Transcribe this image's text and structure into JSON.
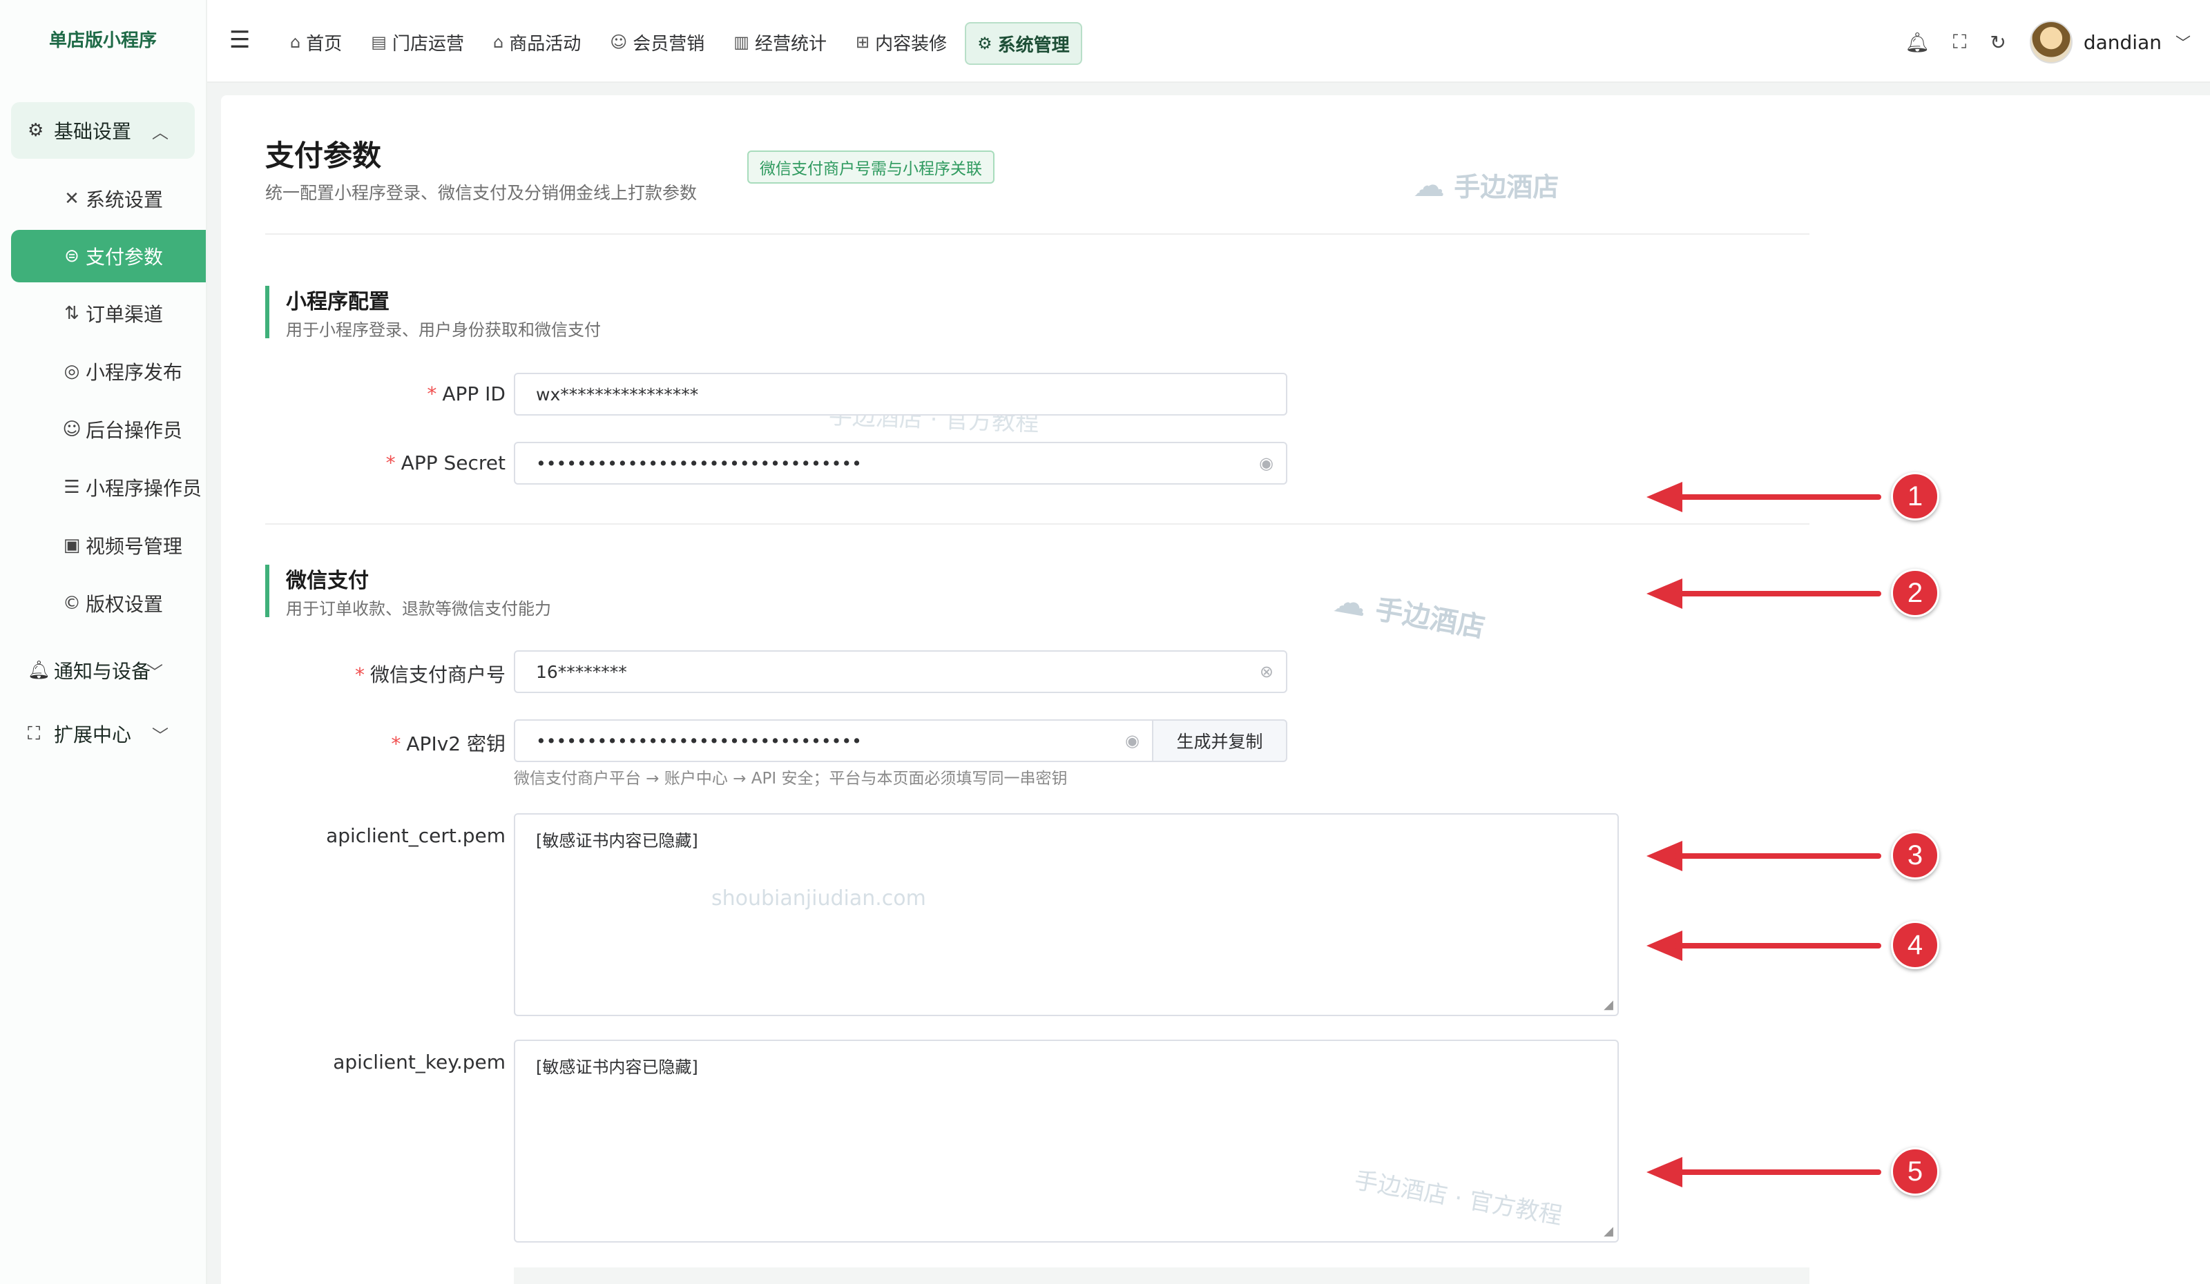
{
  "sidebar": {
    "brand": "单店版小程序",
    "group_basic": "基础设置",
    "items": [
      {
        "label": "系统设置",
        "icon": "tools-icon"
      },
      {
        "label": "支付参数",
        "icon": "wallet-icon"
      },
      {
        "label": "订单渠道",
        "icon": "channel-icon"
      },
      {
        "label": "小程序发布",
        "icon": "publish-icon"
      },
      {
        "label": "后台操作员",
        "icon": "user-circle-icon"
      },
      {
        "label": "小程序操作员",
        "icon": "users-list-icon"
      },
      {
        "label": "视频号管理",
        "icon": "video-icon"
      },
      {
        "label": "版权设置",
        "icon": "copyright-icon"
      }
    ],
    "group_notify": "通知与设备",
    "group_ext": "扩展中心"
  },
  "topbar": {
    "nav": [
      "首页",
      "门店运营",
      "商品活动",
      "会员营销",
      "经营统计",
      "内容装修",
      "系统管理"
    ],
    "username": "dandian"
  },
  "page": {
    "title": "支付参数",
    "subtitle": "统一配置小程序登录、微信支付及分销佣金线上打款参数",
    "tag": "微信支付商户号需与小程序关联"
  },
  "mini": {
    "title": "小程序配置",
    "subtitle": "用于小程序登录、用户身份获取和微信支付",
    "appid_label": "APP ID",
    "appid_value": "wx****************",
    "secret_label": "APP Secret",
    "secret_value": "••••••••••••••••••••••••••••••••"
  },
  "wxpay": {
    "title": "微信支付",
    "subtitle": "用于订单收款、退款等微信支付能力",
    "mch_label": "微信支付商户号",
    "mch_value": "16********",
    "key_label": "APIv2 密钥",
    "key_value": "••••••••••••••••••••••••••••••••",
    "gen_button": "生成并复制",
    "key_hint": "微信支付商户平台 → 账户中心 → API 安全；平台与本页面必须填写同一串密钥",
    "cert_label": "apiclient_cert.pem",
    "cert_value": "[敏感证书内容已隐藏]",
    "keypem_label": "apiclient_key.pem",
    "keypem_value": "[敏感证书内容已隐藏]"
  },
  "watermarks": {
    "brand": "手边酒店",
    "official": "手边酒店 · 官方教程",
    "domain": "shoubianjiudian.com"
  },
  "annotations": [
    "1",
    "2",
    "3",
    "4",
    "5"
  ],
  "colors": {
    "accent": "#3fb07a",
    "annotation": "#e0303a"
  }
}
